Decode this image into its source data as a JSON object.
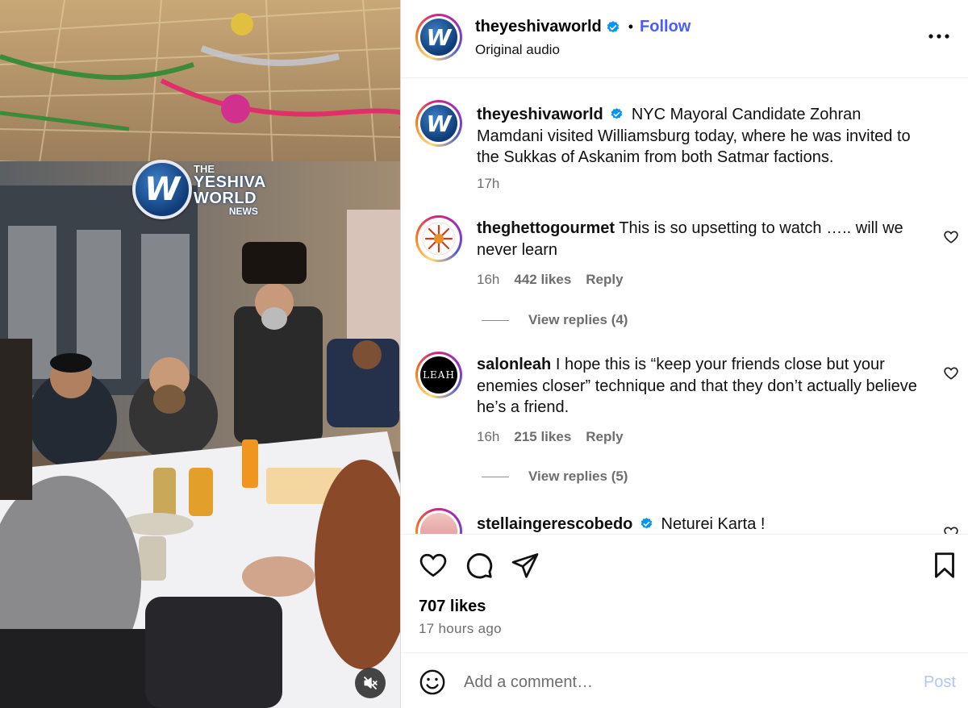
{
  "media": {
    "watermark": {
      "the": "THE",
      "yeshiva": "YESHIVA",
      "world": "WORLD",
      "news": "NEWS",
      "logo_letter": "W"
    },
    "mute_icon": "speaker-muted-icon"
  },
  "header": {
    "username": "theyeshivaworld",
    "separator": "•",
    "follow_label": "Follow",
    "audio": "Original audio",
    "more_icon": "more-horizontal-icon"
  },
  "caption": {
    "username": "theyeshivaworld",
    "text": "NYC Mayoral Candidate Zohran Mamdani visited Williamsburg today, where he was invited to the Sukkas of Askanim from both Satmar factions.",
    "time": "17h"
  },
  "comments": [
    {
      "username": "theghettogourmet",
      "text": "This is so upsetting to watch ….. will we never learn",
      "time": "16h",
      "likes": "442 likes",
      "reply_label": "Reply",
      "view_replies": "View replies (4)"
    },
    {
      "username": "salonleah",
      "text": "I hope this is “keep your friends close but your enemies closer” technique and that they don’t actually believe he’s a friend.",
      "time": "16h",
      "likes": "215 likes",
      "reply_label": "Reply",
      "view_replies": "View replies (5)",
      "avatar_text": "LEAH"
    },
    {
      "username": "stellaingerescobedo",
      "text": "Neturei Karta !"
    }
  ],
  "actions": {
    "like_icon": "heart-icon",
    "comment_icon": "comment-bubble-icon",
    "share_icon": "paper-plane-icon",
    "save_icon": "bookmark-icon",
    "likes": "707 likes",
    "time_ago": "17 hours ago"
  },
  "add_comment": {
    "placeholder": "Add a comment…",
    "post_label": "Post",
    "emoji_icon": "smiley-icon"
  },
  "colors": {
    "link_blue": "#4a5df9",
    "verified_blue": "#0095f6",
    "muted_text": "#6e6e6e",
    "post_disabled": "#b3c5f5"
  }
}
